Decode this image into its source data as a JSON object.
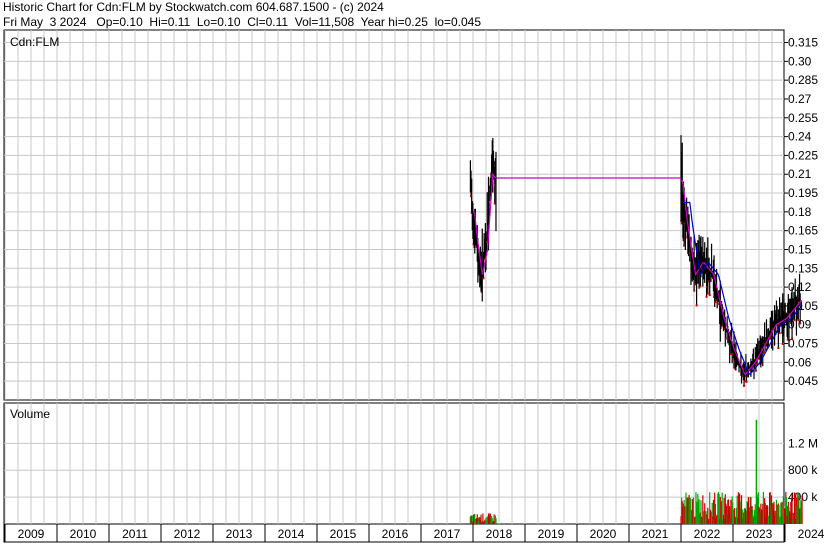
{
  "header": {
    "line1": "Historic Chart for Cdn:FLM by Stockwatch.com 604.687.1500 - (c) 2024",
    "line2": "Fri May  3 2024   Op=0.10  Hi=0.11  Lo=0.10  Cl=0.11  Vol=11,508  Year hi=0.25  lo=0.045"
  },
  "chart_data": [
    {
      "type": "ohlc",
      "title": "Cdn:FLM",
      "y_ticks": [
        "0.315",
        "0.30",
        "0.285",
        "0.27",
        "0.255",
        "0.24",
        "0.225",
        "0.21",
        "0.195",
        "0.18",
        "0.165",
        "0.15",
        "0.135",
        "0.12",
        "0.105",
        "0.09",
        "0.075",
        "0.06",
        "0.045"
      ],
      "ylim": [
        0.03,
        0.325
      ],
      "x_ticks": [
        "2009",
        "2010",
        "2011",
        "2012",
        "2013",
        "2014",
        "2015",
        "2016",
        "2017",
        "2018",
        "2019",
        "2020",
        "2021",
        "2022",
        "2023",
        "2024"
      ],
      "grid": true,
      "colors": {
        "bars": "#000000",
        "ma_short": "#cc00cc",
        "ma_long": "#0000cc",
        "grid": "#c8c8c8",
        "down": "#cc0000"
      },
      "approx_prices": [
        {
          "t": 2017.95,
          "close": 0.2
        },
        {
          "t": 2018.05,
          "close": 0.16
        },
        {
          "t": 2018.15,
          "close": 0.13
        },
        {
          "t": 2018.25,
          "close": 0.15
        },
        {
          "t": 2018.35,
          "close": 0.21
        },
        {
          "t": 2018.45,
          "close": 0.205
        },
        {
          "t": 2022.0,
          "close": 0.205
        },
        {
          "t": 2022.1,
          "close": 0.17
        },
        {
          "t": 2022.25,
          "close": 0.13
        },
        {
          "t": 2022.4,
          "close": 0.14
        },
        {
          "t": 2022.6,
          "close": 0.13
        },
        {
          "t": 2022.8,
          "close": 0.095
        },
        {
          "t": 2023.0,
          "close": 0.07
        },
        {
          "t": 2023.2,
          "close": 0.05
        },
        {
          "t": 2023.4,
          "close": 0.06
        },
        {
          "t": 2023.6,
          "close": 0.075
        },
        {
          "t": 2023.8,
          "close": 0.09
        },
        {
          "t": 2024.0,
          "close": 0.095
        },
        {
          "t": 2024.3,
          "close": 0.11
        }
      ]
    },
    {
      "type": "bar",
      "title": "Volume",
      "y_ticks": [
        "1.2 M",
        "800 k",
        "400 k"
      ],
      "ylim": [
        0,
        1800000
      ],
      "colors": {
        "up": "#00aa00",
        "down": "#cc0000"
      },
      "approx_volume_2018_2018_5": 100000,
      "approx_volume_2022_2024_typical": 300000,
      "approx_volume_peak": 1550000
    }
  ]
}
